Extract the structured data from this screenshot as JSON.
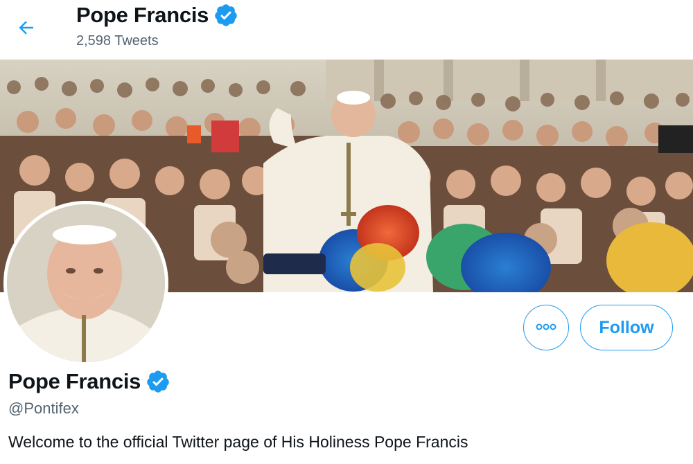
{
  "header": {
    "name": "Pope Francis",
    "tweet_count": "2,598 Tweets",
    "back_icon": "arrow-left-icon",
    "verified_icon": "verified-badge-icon"
  },
  "banner": {
    "image_description_icon": "crowd-banner-image"
  },
  "profile": {
    "name": "Pope Francis",
    "handle": "@Pontifex",
    "bio": "Welcome to the official Twitter page of His Holiness Pope Francis",
    "avatar_icon": "profile-avatar-image"
  },
  "actions": {
    "more_icon": "more-options-icon",
    "follow_label": "Follow"
  },
  "colors": {
    "accent": "#1d9bf0",
    "text_primary": "#0f1419",
    "text_secondary": "#536471",
    "background": "#ffffff"
  }
}
